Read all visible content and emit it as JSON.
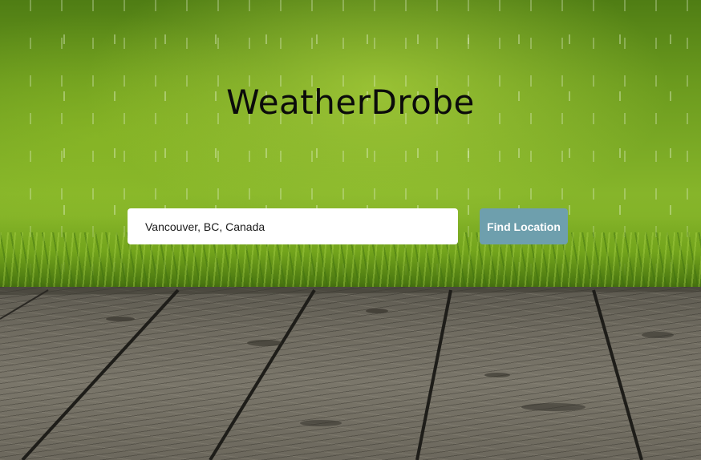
{
  "app": {
    "title": "WeatherDrobe"
  },
  "search": {
    "value": "Vancouver, BC, Canada",
    "button_label": "Find Location"
  },
  "colors": {
    "button_bg": "#6e9fad",
    "button_text": "#ffffff",
    "title_text": "#0b0b0b",
    "input_bg": "#ffffff"
  }
}
